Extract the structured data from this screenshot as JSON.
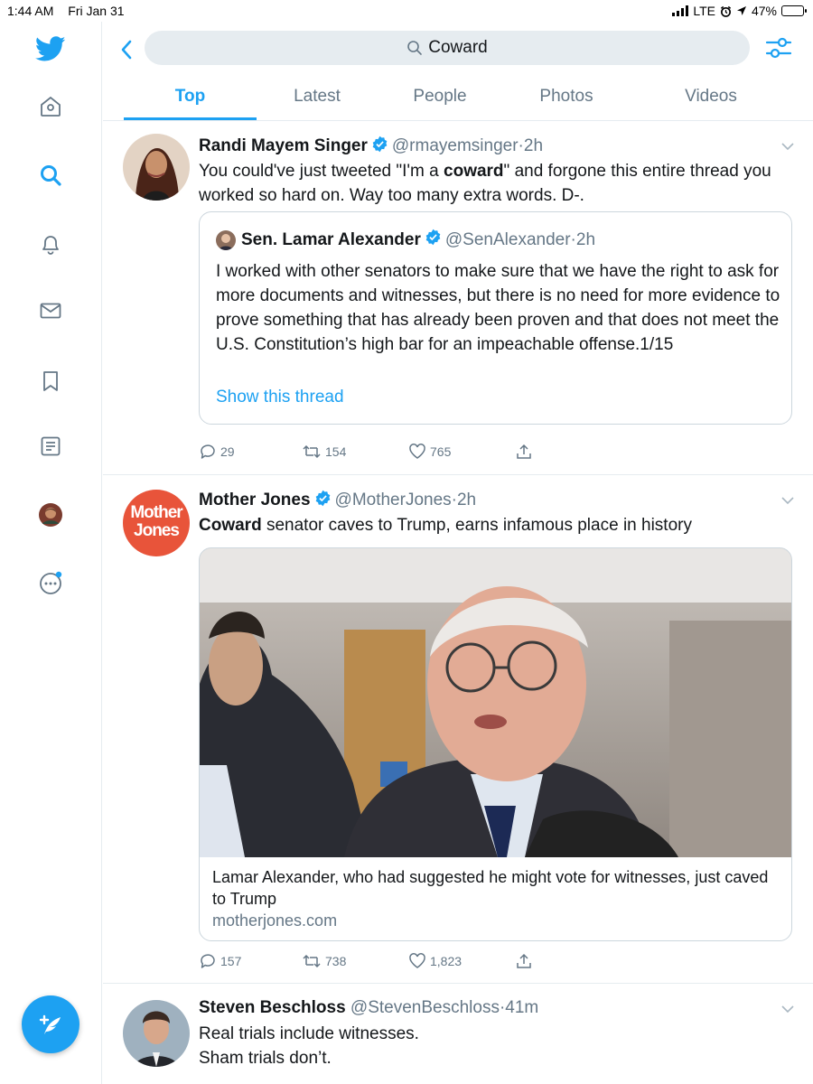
{
  "status_bar": {
    "time": "1:44 AM",
    "date": "Fri Jan 31",
    "network": "LTE",
    "battery": "47%",
    "battery_level": 0.47
  },
  "rail": {
    "items": [
      {
        "name": "home-icon"
      },
      {
        "name": "search-icon",
        "active": true
      },
      {
        "name": "bell-icon"
      },
      {
        "name": "mail-icon"
      },
      {
        "name": "bookmark-icon"
      },
      {
        "name": "list-icon"
      },
      {
        "name": "profile-avatar"
      },
      {
        "name": "more-icon"
      }
    ],
    "compose_icon": "compose-icon"
  },
  "header": {
    "search_value": "Coward",
    "tabs": [
      {
        "label": "Top",
        "active": true
      },
      {
        "label": "Latest"
      },
      {
        "label": "People"
      },
      {
        "label": "Photos"
      },
      {
        "label": "Videos"
      }
    ]
  },
  "colors": {
    "accent": "#1da1f2",
    "text": "#14171a",
    "secondary": "#657786",
    "border": "#e6ecf0",
    "mother_jones_red": "#e8543a"
  },
  "tweets": [
    {
      "name": "Randi Mayem Singer",
      "handle": "@rmayemsinger",
      "dot": "·",
      "time": "2h",
      "text_before": "You could've just tweeted \"I'm a ",
      "text_bold": "coward",
      "text_after": "\" and forgone this entire thread you worked so hard on. Way too many extra words. D-.",
      "quote": {
        "name": "Sen. Lamar Alexander",
        "handle": "@SenAlexander",
        "dot": "·",
        "time": "2h",
        "text": "I worked with other senators to make sure that we have the right to ask for more documents and witnesses, but there is no need for more evidence to prove something that has already been proven and that does not meet the U.S. Constitution’s high bar for an impeachable offense.1/15",
        "link": "Show this thread"
      },
      "replies": "29",
      "retweets": "154",
      "likes": "765"
    },
    {
      "name": "Mother Jones",
      "avatar_text_1": "Mother",
      "avatar_text_2": "Jones",
      "handle": "@MotherJones",
      "dot": "·",
      "time": "2h",
      "text_bold": "Coward",
      "text_after": " senator caves to Trump, earns infamous place in history",
      "card": {
        "title": "Lamar Alexander, who had suggested he might vote for witnesses, just caved to Trump",
        "domain": "motherjones.com"
      },
      "replies": "157",
      "retweets": "738",
      "likes": "1,823"
    },
    {
      "name": "Steven Beschloss",
      "handle": "@StevenBeschloss",
      "dot": "·",
      "time": "41m",
      "line1": "Real trials include witnesses.",
      "line2": "Sham trials don’t."
    }
  ]
}
